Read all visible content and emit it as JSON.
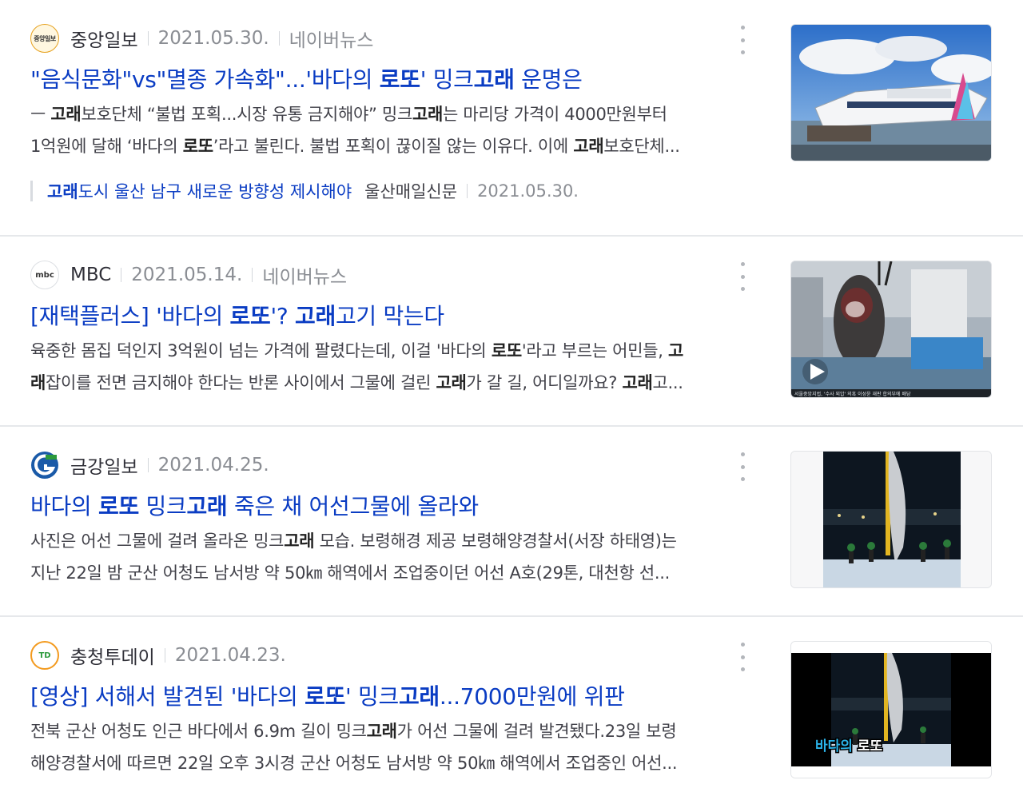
{
  "articles": [
    {
      "press": "중앙일보",
      "date": "2021.05.30.",
      "source": "네이버뉴스",
      "title": [
        "\"음식문화\"vs\"멸종 가속화\"...'바다의 ",
        "로또",
        "' 밍크",
        "고래",
        " 운명은"
      ],
      "desc1": [
        "ㅡ ",
        "고래",
        "보호단체 “불법 포획...시장 유통 금지해야” 밍크",
        "고래",
        "는 마리당 가격이 4000만원부터"
      ],
      "desc2": [
        "1억원에 달해 ‘바다의 ",
        "로또",
        "’라고 불린다. 불법 포획이 끊이질 않는 이유다. 이에 ",
        "고래",
        "보호단체..."
      ],
      "related": {
        "title": [
          "고래",
          "도시 울산 남구 새로운 방향성 제시해야"
        ],
        "press": "울산매일신문",
        "date": "2021.05.30."
      }
    },
    {
      "press": "MBC",
      "logo_text": "mbc",
      "date": "2021.05.14.",
      "source": "네이버뉴스",
      "title": [
        "[재택플러스] '바다의 ",
        "로또",
        "'? ",
        "고래",
        "고기 막는다"
      ],
      "desc1": [
        "육중한 몸집 덕인지 3억원이 넘는 가격에 팔렸다는데, 이걸 '바다의 ",
        "로또",
        "'라고 부르는 어민들, ",
        "고",
        ""
      ],
      "desc2": [
        "",
        "래",
        "잡이를 전면 금지해야 한다는 반론 사이에서 그물에 걸린 ",
        "고래",
        "가 갈 길, 어디일까요? ",
        "고래",
        "고..."
      ],
      "caption": "서울중앙지법, '수사 외압' 의혹 이성윤 재판 합의부에 배당"
    },
    {
      "press": "금강일보",
      "date": "2021.04.25.",
      "title": [
        "바다의 ",
        "로또",
        " 밍크",
        "고래",
        " 죽은 채 어선그물에 올라와"
      ],
      "desc1": [
        "사진은 어선 그물에 걸려 올라온 밍크",
        "고래",
        " 모습. 보령해경 제공 보령해양경찰서(서장 하태영)는"
      ],
      "desc2": [
        "지난 22일 밤 군산 어청도 남서방 약 50㎞ 해역에서 조업중이던 어선 A호(29톤, 대천항 선..."
      ]
    },
    {
      "press": "충청투데이",
      "logo_text": "TD",
      "date": "2021.04.23.",
      "title": [
        "[영상] 서해서 발견된 '바다의 ",
        "로또",
        "' 밍크",
        "고래",
        "...7000만원에 위판"
      ],
      "desc1": [
        " 전북 군산 어청도 인근 바다에서 6.9m 길이 밍크",
        "고래",
        "가 어선 그물에 걸려 발견됐다.23일 보령"
      ],
      "desc2": [
        "해양경찰서에 따르면 22일 오후 3시경 군산 어청도 남서방 약 50㎞ 해역에서 조업중인 어선..."
      ],
      "overlay": [
        "바다의 ",
        "로또"
      ]
    }
  ],
  "colors": {
    "link": "#0a3cc3",
    "muted": "#8a8d93",
    "divider": "#e6e8eb"
  }
}
